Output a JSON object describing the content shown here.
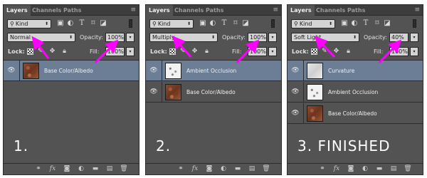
{
  "tabs": [
    "Layers",
    "Channels",
    "Paths"
  ],
  "kind_label": "Kind",
  "opacity_label": "Opacity:",
  "lock_label": "Lock:",
  "fill_label": "Fill:",
  "panels": [
    {
      "blend_mode": "Normal",
      "opacity": "100%",
      "fill": "100%",
      "step_label": "1.",
      "layers": [
        {
          "name": "Base Color/Albedo",
          "thumb": "albedo",
          "selected": true
        }
      ]
    },
    {
      "blend_mode": "Multiply",
      "opacity": "100%",
      "fill": "100%",
      "step_label": "2.",
      "layers": [
        {
          "name": "Ambient Occlusion",
          "thumb": "ao",
          "selected": true
        },
        {
          "name": "Base Color/Albedo",
          "thumb": "albedo",
          "selected": false
        }
      ]
    },
    {
      "blend_mode": "Soft Light",
      "opacity": "40%",
      "fill": "100%",
      "step_label": "3. FINISHED",
      "layers": [
        {
          "name": "Curvature",
          "thumb": "curv",
          "selected": true
        },
        {
          "name": "Ambient Occlusion",
          "thumb": "ao",
          "selected": false
        },
        {
          "name": "Base Color/Albedo",
          "thumb": "albedo",
          "selected": false
        }
      ]
    }
  ],
  "colors": {
    "panel_bg": "#535353",
    "selected_row": "#6c7e96",
    "annotation_arrow": "#ff00ff"
  }
}
